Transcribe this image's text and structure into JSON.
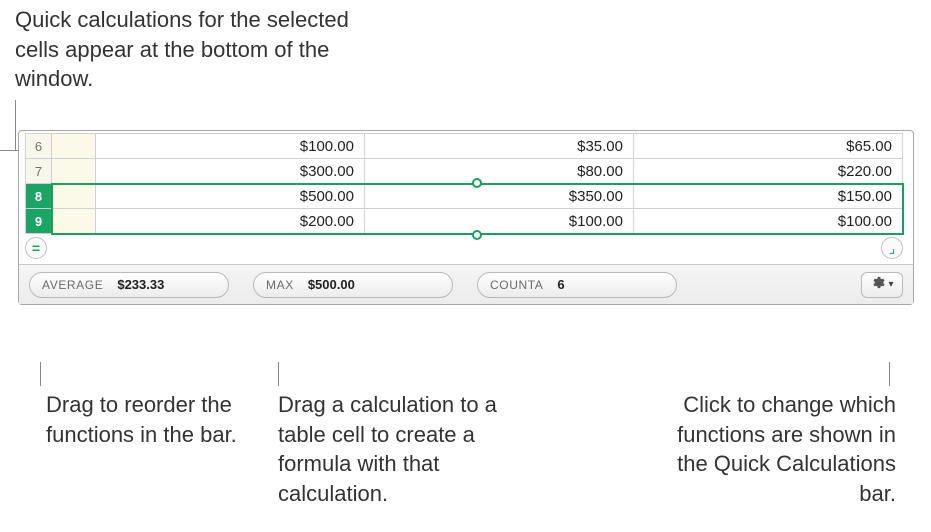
{
  "callouts": {
    "top": "Quick calculations for the selected cells appear at the bottom of the window.",
    "b1": "Drag to reorder the functions in the bar.",
    "b2": "Drag a calculation to a table cell to create a formula with that calculation.",
    "b3": "Click to change which functions are shown in the Quick Calculations bar."
  },
  "sheet": {
    "rows": [
      {
        "hdr": "6",
        "selected": false,
        "cells": [
          "$100.00",
          "$35.00",
          "$65.00"
        ]
      },
      {
        "hdr": "7",
        "selected": false,
        "cells": [
          "$300.00",
          "$80.00",
          "$220.00"
        ]
      },
      {
        "hdr": "8",
        "selected": true,
        "cells": [
          "$500.00",
          "$350.00",
          "$150.00"
        ]
      },
      {
        "hdr": "9",
        "selected": true,
        "cells": [
          "$200.00",
          "$100.00",
          "$100.00"
        ]
      }
    ]
  },
  "qc": {
    "items": [
      {
        "fn": "AVERAGE",
        "val": "$233.33"
      },
      {
        "fn": "MAX",
        "val": "$500.00"
      },
      {
        "fn": "COUNTA",
        "val": "6"
      }
    ]
  },
  "corner_left_glyph": "=",
  "corner_right_glyph": "⌟"
}
